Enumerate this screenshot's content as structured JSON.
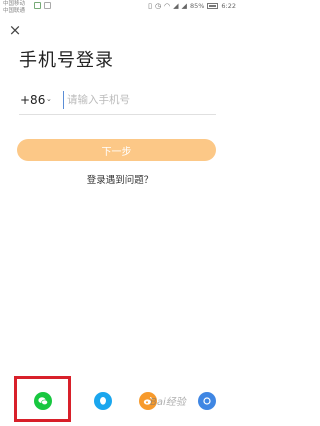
{
  "status_bar": {
    "carrier_1": "中国移动",
    "carrier_2": "中国联通",
    "battery": "85%",
    "time": "6:22",
    "icons": [
      "wechat-notification-icon",
      "app-notification-icon",
      "vibrate-icon",
      "alarm-icon",
      "wifi-icon",
      "signal-icon",
      "battery-icon"
    ]
  },
  "header": {
    "close_icon": "×",
    "title": "手机号登录"
  },
  "form": {
    "country_code": "+86",
    "phone_placeholder": "请输入手机号",
    "next_label": "下一步",
    "help_link": "登录遇到问题？"
  },
  "social_login": {
    "items": [
      "wechat-icon",
      "qq-icon",
      "weibo-icon",
      "more-login-icon"
    ],
    "highlighted": "wechat-icon",
    "highlight_color": "#d8202a"
  },
  "watermark": "Bai经验",
  "colors": {
    "next_button": "#fcc887",
    "wechat": "#17c73f",
    "qq": "#1aa6ee",
    "weibo": "#f79a2c"
  }
}
